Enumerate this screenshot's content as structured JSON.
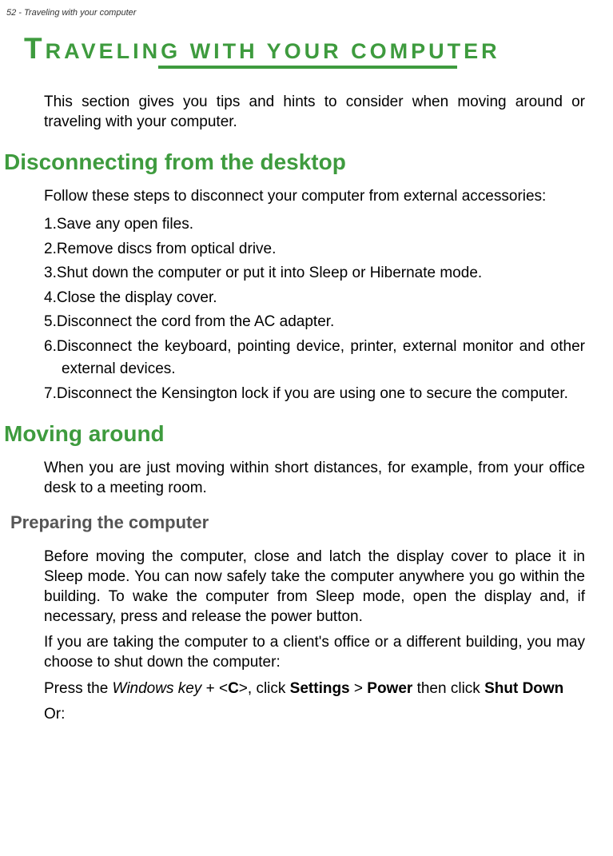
{
  "header": {
    "text": "52 - Traveling with your computer"
  },
  "title": {
    "firstLetter": "T",
    "rest": "RAVELING WITH YOUR COMPUTER"
  },
  "intro": "This section gives you tips and hints to consider when moving around or traveling with your computer.",
  "section1": {
    "heading": "Disconnecting from the desktop",
    "intro": "Follow these steps to disconnect your computer from external accessories:",
    "steps": [
      "Save any open files.",
      "Remove discs from optical drive.",
      "Shut down the computer or put it into Sleep or Hibernate mode.",
      "Close the display cover.",
      "Disconnect the cord from the AC adapter.",
      "Disconnect the keyboard, pointing device, printer, external monitor and other external devices.",
      "Disconnect the Kensington lock if you are using one to secure the computer."
    ],
    "stepPrefixes": [
      "1.",
      "2.",
      "3.",
      "4.",
      "5.",
      "6.",
      "7."
    ]
  },
  "section2": {
    "heading": "Moving around",
    "intro": "When you are just moving within short distances, for example, from your office desk to a meeting room.",
    "sub1": {
      "heading": "Preparing the computer",
      "para1": "Before moving the computer, close and latch the display cover to place it in Sleep mode. You can now safely take the computer anywhere you go within the building. To wake the computer from Sleep mode, open the display and, if necessary, press and release the power button.",
      "para2": "If you are taking the computer to a client's office or a different building, you may choose to shut down the computer:",
      "para3_pre": "Press the ",
      "para3_winkey": "Windows key",
      "para3_mid1": " + <",
      "para3_C": "C",
      "para3_mid2": ">, click ",
      "para3_settings": "Settings",
      "para3_mid3": " > ",
      "para3_power": "Power",
      "para3_mid4": " then click ",
      "para3_shutdown": "Shut Down",
      "para4": "Or:"
    }
  }
}
